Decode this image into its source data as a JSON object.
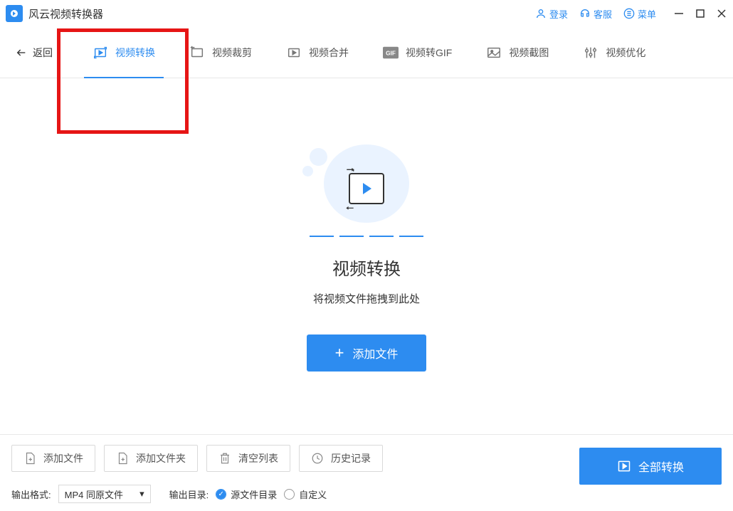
{
  "app": {
    "title": "风云视频转换器"
  },
  "titlebar": {
    "login": "登录",
    "support": "客服",
    "menu": "菜单"
  },
  "toolbar": {
    "back": "返回",
    "tabs": [
      {
        "label": "视频转换"
      },
      {
        "label": "视频裁剪"
      },
      {
        "label": "视频合并"
      },
      {
        "label": "视频转GIF"
      },
      {
        "label": "视频截图"
      },
      {
        "label": "视频优化"
      }
    ]
  },
  "main": {
    "title": "视频转换",
    "subtitle": "将视频文件拖拽到此处",
    "add_file": "添加文件"
  },
  "bottom": {
    "add_file": "添加文件",
    "add_folder": "添加文件夹",
    "clear_list": "清空列表",
    "history": "历史记录",
    "convert_all": "全部转换",
    "output_format_label": "输出格式:",
    "output_format_value": "MP4 同原文件",
    "output_dir_label": "输出目录:",
    "radio_source": "源文件目录",
    "radio_custom": "自定义"
  }
}
